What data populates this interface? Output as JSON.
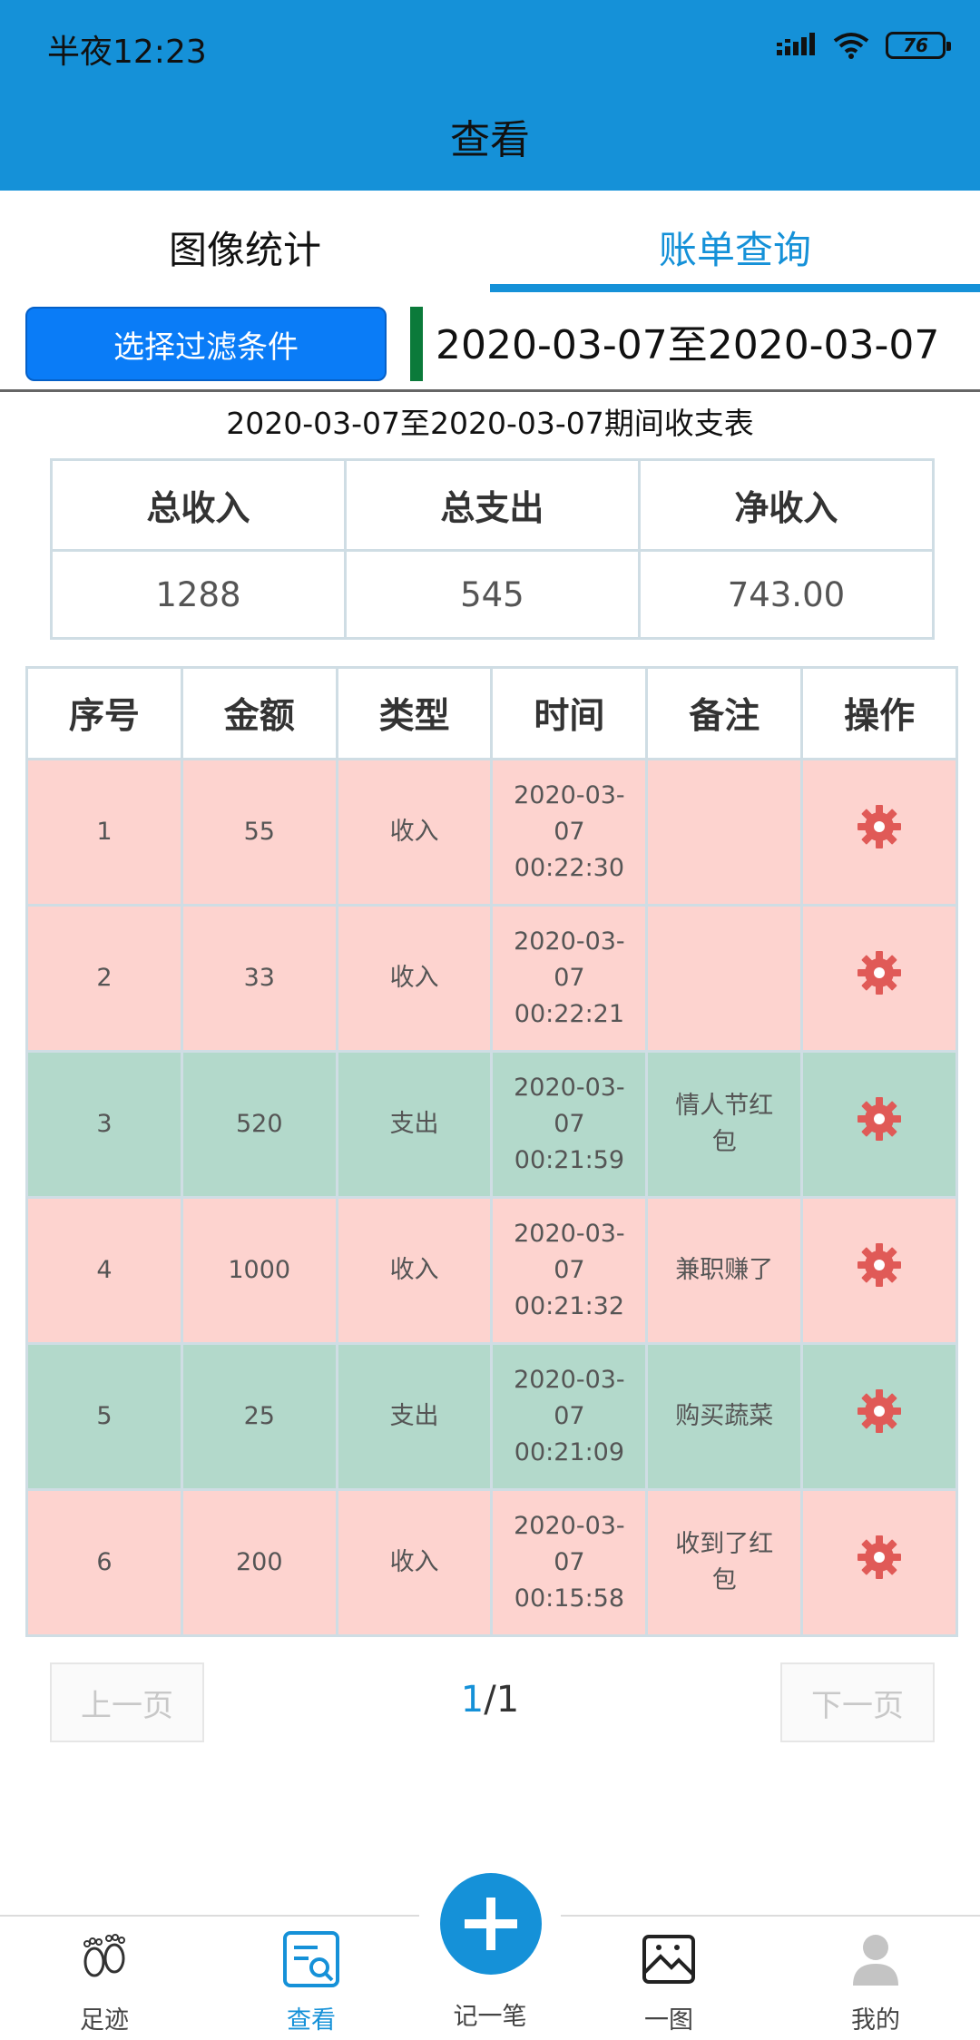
{
  "status_bar": {
    "time": "半夜12:23",
    "battery": "76"
  },
  "header": {
    "title": "查看"
  },
  "tabs": [
    {
      "label": "图像统计",
      "active": false
    },
    {
      "label": "账单查询",
      "active": true
    }
  ],
  "filter": {
    "button_label": "选择过滤条件",
    "date_range": "2020-03-07至2020-03-07"
  },
  "summary": {
    "title": "2020-03-07至2020-03-07期间收支表",
    "headers": [
      "总收入",
      "总支出",
      "净收入"
    ],
    "values": [
      "1288",
      "545",
      "743.00"
    ]
  },
  "bill_table": {
    "headers": [
      "序号",
      "金额",
      "类型",
      "时间",
      "备注",
      "操作"
    ],
    "rows": [
      {
        "no": "1",
        "amount": "55",
        "type": "收入",
        "time_l1": "2020-03-",
        "time_l2": "07",
        "time_l3": "00:22:30",
        "note": "",
        "kind": "income"
      },
      {
        "no": "2",
        "amount": "33",
        "type": "收入",
        "time_l1": "2020-03-",
        "time_l2": "07",
        "time_l3": "00:22:21",
        "note": "",
        "kind": "income"
      },
      {
        "no": "3",
        "amount": "520",
        "type": "支出",
        "time_l1": "2020-03-",
        "time_l2": "07",
        "time_l3": "00:21:59",
        "note": "情人节红包",
        "kind": "expense"
      },
      {
        "no": "4",
        "amount": "1000",
        "type": "收入",
        "time_l1": "2020-03-",
        "time_l2": "07",
        "time_l3": "00:21:32",
        "note": "兼职赚了",
        "kind": "income"
      },
      {
        "no": "5",
        "amount": "25",
        "type": "支出",
        "time_l1": "2020-03-",
        "time_l2": "07",
        "time_l3": "00:21:09",
        "note": "购买蔬菜",
        "kind": "expense"
      },
      {
        "no": "6",
        "amount": "200",
        "type": "收入",
        "time_l1": "2020-03-",
        "time_l2": "07",
        "time_l3": "00:15:58",
        "note": "收到了红包",
        "kind": "income"
      }
    ],
    "action_icon": "gear-icon"
  },
  "pager": {
    "prev_label": "上一页",
    "next_label": "下一页",
    "current": "1",
    "separator": "/",
    "total": "1"
  },
  "bottom_nav": {
    "items": [
      {
        "label": "足迹",
        "icon": "footprints-icon"
      },
      {
        "label": "查看",
        "icon": "view-icon",
        "active": true
      },
      {
        "label": "一图",
        "icon": "picture-icon"
      },
      {
        "label": "我的",
        "icon": "user-icon"
      }
    ],
    "add_label": "记一笔"
  },
  "colors": {
    "primary": "#1591d8",
    "filter_button": "#0a7cf7",
    "income_row": "#fdd3cf",
    "expense_row": "#b3d9cb",
    "gear": "#e05a57"
  }
}
